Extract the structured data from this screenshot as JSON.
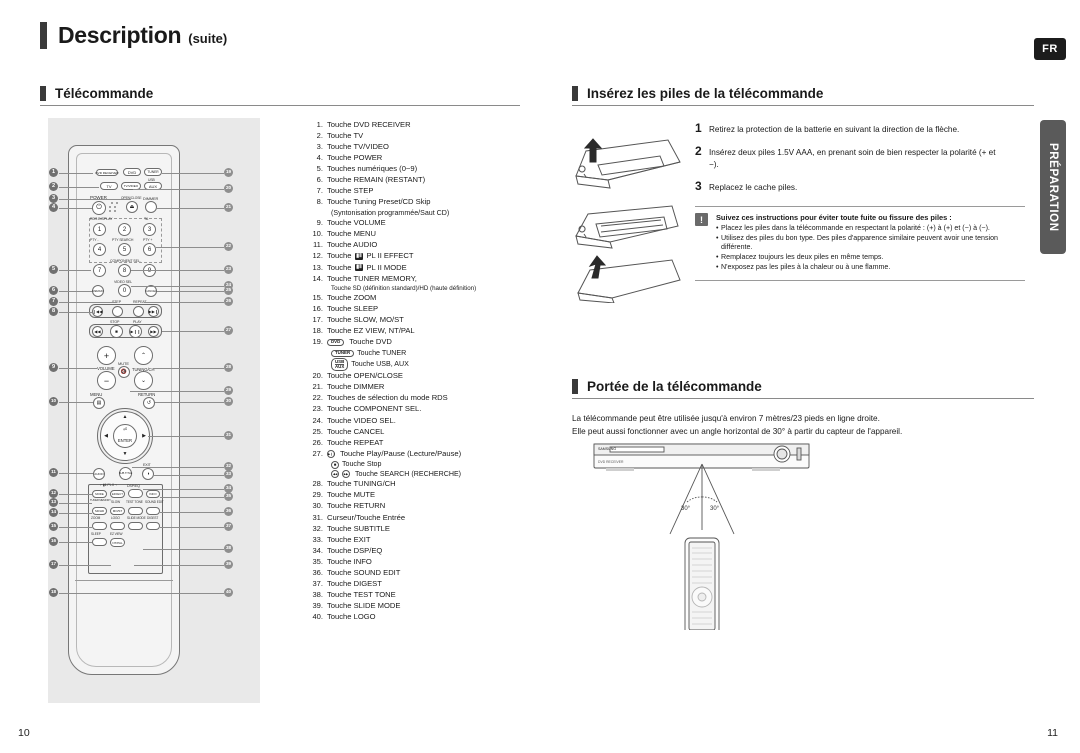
{
  "page": {
    "title": "Description",
    "title_suffix": "(suite)",
    "language_badge": "FR",
    "side_tab": "PRÉPARATION",
    "page_number_left": "10",
    "page_number_right": "11"
  },
  "sections": {
    "remote": {
      "title": "Télécommande"
    },
    "batteries": {
      "title": "Insérez les piles de la télécommande"
    },
    "range": {
      "title": "Portée de la télécommande"
    }
  },
  "button_list": [
    {
      "num": "1.",
      "text": "Touche DVD RECEIVER"
    },
    {
      "num": "2.",
      "text": "Touche TV"
    },
    {
      "num": "3.",
      "text": "Touche TV/VIDEO"
    },
    {
      "num": "4.",
      "text": "Touche POWER"
    },
    {
      "num": "5.",
      "text": "Touches numériques (0~9)"
    },
    {
      "num": "6.",
      "text": "Touche REMAIN (RESTANT)"
    },
    {
      "num": "7.",
      "text": "Touche STEP"
    },
    {
      "num": "8.",
      "text": "Touche Tuning Preset/CD Skip",
      "sub": "(Syntonisation programmée/Saut CD)"
    },
    {
      "num": "9.",
      "text": "Touche VOLUME"
    },
    {
      "num": "10.",
      "text": "Touche MENU"
    },
    {
      "num": "11.",
      "text": "Touche AUDIO"
    },
    {
      "num": "12.",
      "text": "Touche",
      "pl2": "PL II EFFECT"
    },
    {
      "num": "13.",
      "text": "Touche",
      "pl2": "PL II MODE"
    },
    {
      "num": "14.",
      "text": "Touche TUNER MEMORY,",
      "sub_small": "Touche SD (définition standard)/HD (haute définition)"
    },
    {
      "num": "15.",
      "text": "Touche ZOOM"
    },
    {
      "num": "16.",
      "text": "Touche SLEEP"
    },
    {
      "num": "17.",
      "text": "Touche SLOW, MO/ST"
    },
    {
      "num": "18.",
      "text": "Touche EZ VIEW, NT/PAL"
    },
    {
      "num": "19.",
      "text": "Touche DVD",
      "cap": "DVD",
      "extra": [
        {
          "cap": "TUNER",
          "text": "Touche TUNER"
        },
        {
          "cap2": [
            "USB",
            "AUX"
          ],
          "text": "Touche USB, AUX"
        }
      ]
    },
    {
      "num": "20.",
      "text": "Touche OPEN/CLOSE"
    },
    {
      "num": "21.",
      "text": "Touche DIMMER"
    },
    {
      "num": "22.",
      "text": "Touches de sélection du mode RDS"
    },
    {
      "num": "23.",
      "text": "Touche COMPONENT SEL."
    },
    {
      "num": "24.",
      "text": "Touche VIDEO SEL."
    },
    {
      "num": "25.",
      "text": "Touche CANCEL"
    },
    {
      "num": "26.",
      "text": "Touche REPEAT"
    },
    {
      "num": "27.",
      "text": "Touche Play/Pause (Lecture/Pause)",
      "glyph": "▶❙❙",
      "extra": [
        {
          "glyph": "■",
          "text": "Touche Stop"
        },
        {
          "glyph2": [
            "◀◀",
            "▶▶"
          ],
          "text": "Touche SEARCH (RECHERCHE)"
        }
      ]
    },
    {
      "num": "28.",
      "text": "Touche TUNING/CH"
    },
    {
      "num": "29.",
      "text": "Touche MUTE"
    },
    {
      "num": "30.",
      "text": "Touche RETURN"
    },
    {
      "num": "31.",
      "text": "Curseur/Touche Entrée"
    },
    {
      "num": "32.",
      "text": "Touche SUBTITLE"
    },
    {
      "num": "33.",
      "text": "Touche EXIT"
    },
    {
      "num": "34.",
      "text": "Touche DSP/EQ"
    },
    {
      "num": "35.",
      "text": "Touche INFO"
    },
    {
      "num": "36.",
      "text": "Touche SOUND EDIT"
    },
    {
      "num": "37.",
      "text": "Touche DIGEST"
    },
    {
      "num": "38.",
      "text": "Touche TEST TONE"
    },
    {
      "num": "39.",
      "text": "Touche SLIDE MODE"
    },
    {
      "num": "40.",
      "text": "Touche LOGO"
    }
  ],
  "remote_diagram": {
    "key_labels": [
      "DVD RECEIVER",
      "DVD",
      "TUNER",
      "USB",
      "AUX",
      "TV",
      "TV/VIDEO",
      "POWER",
      "OPEN/CLOSE",
      "DIMMER",
      "RDS DISPLAY",
      "TA",
      "PTY -",
      "PTY SEARCH",
      "PTY +",
      "COMPONENT SEL.",
      "VIDEO SEL",
      "REMAIN",
      "CANCEL",
      "STEP",
      "REPEAT",
      "STOP",
      "PLAY",
      "VOLUME",
      "MUTE",
      "TUNING/CH",
      "MENU",
      "RETURN",
      "ENTER",
      "SUBTITLE",
      "EXIT",
      "DSP/EQ",
      "INFO",
      "PL II",
      "DISPLAY",
      "MODE",
      "EFFECT",
      "TUNER MEMORY",
      "SD/HD",
      "SLOW",
      "MO/ST",
      "TEST TONE",
      "SOUND EDIT",
      "ZOOM",
      "LOGO",
      "SLIDE MODE",
      "DIGEST",
      "SLEEP",
      "EZ VIEW",
      "NT/PAL",
      "AUDIO"
    ],
    "digits": [
      "1",
      "2",
      "3",
      "4",
      "5",
      "6",
      "7",
      "8",
      "9",
      "0"
    ],
    "callouts_left": [
      "1",
      "2",
      "3",
      "4",
      "5",
      "6",
      "7",
      "8",
      "9",
      "10",
      "11",
      "12",
      "13",
      "14",
      "15",
      "16",
      "17",
      "18"
    ],
    "callouts_right": [
      "19",
      "20",
      "21",
      "22",
      "23",
      "24",
      "25",
      "26",
      "27",
      "28",
      "29",
      "30",
      "31",
      "32",
      "33",
      "34",
      "35",
      "36",
      "37",
      "38",
      "39",
      "40"
    ]
  },
  "battery_steps": [
    {
      "num": "1",
      "text": "Retirez la protection de la batterie en suivant la direction de la flèche."
    },
    {
      "num": "2",
      "text": "Insérez deux piles 1.5V AAA, en prenant soin de bien respecter la polarité (+ et −)."
    },
    {
      "num": "3",
      "text": "Replacez le cache piles."
    }
  ],
  "warning": {
    "icon": "!",
    "title": "Suivez ces instructions pour éviter toute fuite ou fissure des piles :",
    "items": [
      "Placez les piles dans la télécommande en respectant la polarité : (+) à (+) et (−) à (−).",
      "Utilisez des piles du bon type. Des piles d'apparence similaire peuvent avoir une tension différente.",
      "Remplacez toujours les deux piles en même temps.",
      "N'exposez pas les piles à la chaleur ou à une flamme."
    ]
  },
  "range": {
    "line1": "La télécommande peut être utilisée jusqu'à environ 7 mètres/23 pieds en ligne droite.",
    "line2": "Elle peut aussi fonctionner avec un angle horizontal de 30° à partir du capteur de l'appareil.",
    "angle_left": "30°",
    "angle_right": "30°",
    "device_brand": "SAMSUNG",
    "device_label": "DVD RECEIVER"
  },
  "colors": {
    "accent_bar": "#3a3a3a",
    "panel_bg": "#e9e9e9",
    "badge_bg": "#1c1c1c",
    "side_tab_bg": "#5a5a5a",
    "rule": "#8a8a8a"
  }
}
